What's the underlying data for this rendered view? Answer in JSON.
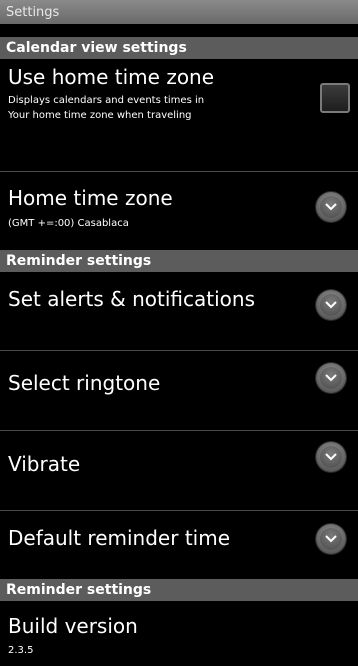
{
  "title_bar": {
    "title": "Settings"
  },
  "sections": {
    "calendar_view": {
      "header": "Calendar view settings",
      "use_home_time_zone": {
        "title": "Use home time zone",
        "summary_line1": "Displays calendars and events times in",
        "summary_line2": "Your home time zone when traveling",
        "checked": false
      },
      "home_time_zone": {
        "title": "Home time zone",
        "summary": "(GMT +=:00) Casablaca"
      }
    },
    "reminder": {
      "header": "Reminder settings",
      "items": [
        {
          "title": "Set alerts & notifications"
        },
        {
          "title": "Select ringtone"
        },
        {
          "title": "Vibrate"
        },
        {
          "title": "Default reminder time"
        }
      ]
    },
    "about": {
      "header": "Reminder settings",
      "build_version": {
        "title": "Build version",
        "value": "2.3.5"
      }
    }
  },
  "colors": {
    "background": "#000000",
    "section_header": "#5c5c5c",
    "divider": "#4a4a4a",
    "text": "#ffffff"
  },
  "icons": {
    "dropdown": "chevron-down-icon",
    "checkbox": "checkbox-unchecked"
  }
}
